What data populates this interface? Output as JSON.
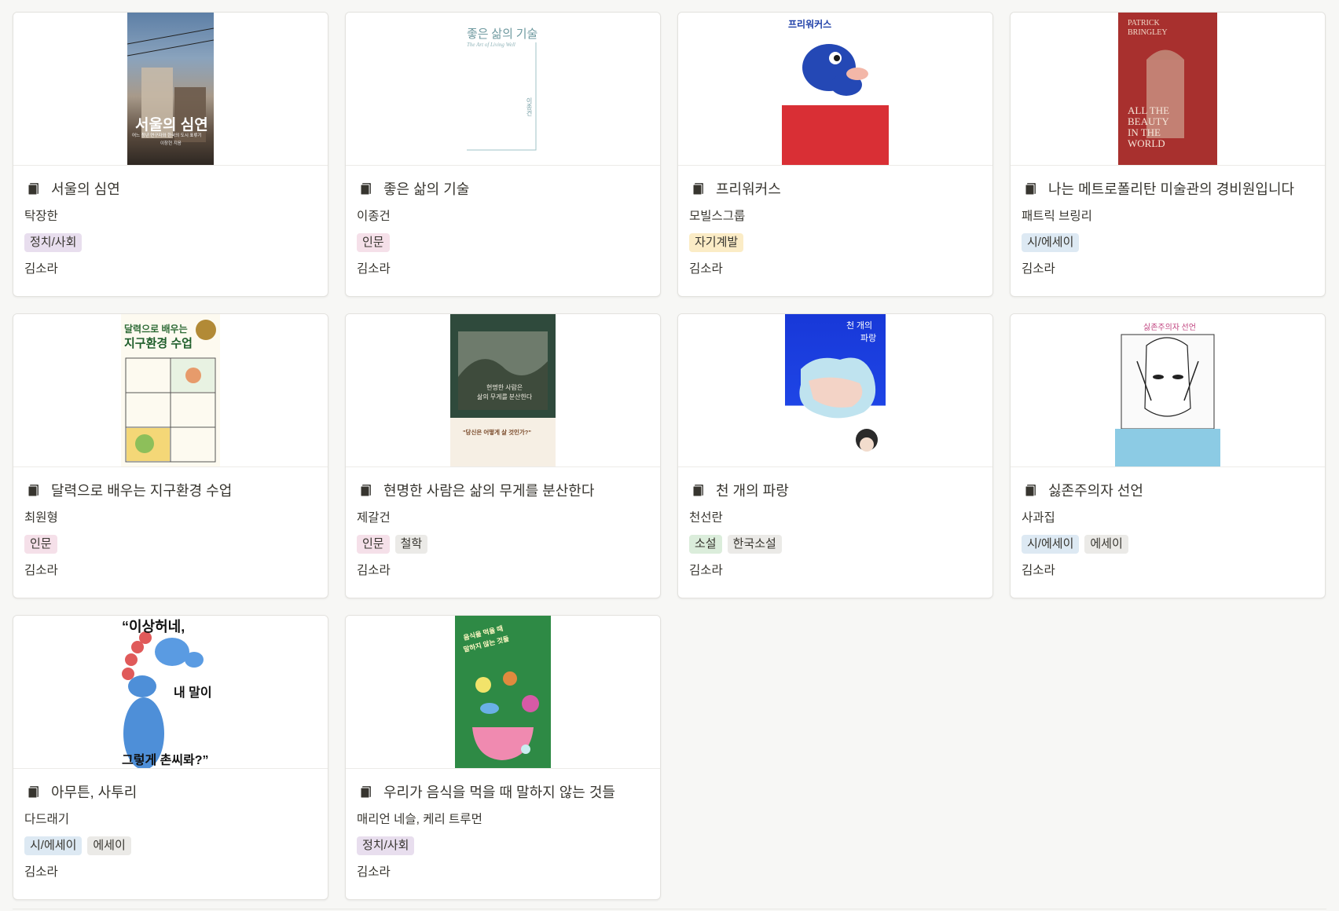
{
  "cards": [
    {
      "title": "서울의 심연",
      "author": "탁장한",
      "tags": [
        {
          "label": "정치/사회",
          "color": "purple"
        }
      ],
      "reader": "김소라",
      "cover": {
        "text": "서울의 심연",
        "sub": "어느 청년 연구자와 한국의 도시 표류기",
        "credit": "이창현 지음"
      }
    },
    {
      "title": "좋은 삶의 기술",
      "author": "이종건",
      "tags": [
        {
          "label": "인문",
          "color": "pink"
        }
      ],
      "reader": "김소라",
      "cover": {
        "text": "좋은 삶의 기술",
        "sub": "The Art of Living Well",
        "credit": "이종건"
      }
    },
    {
      "title": "프리워커스",
      "author": "모빌스그룹",
      "tags": [
        {
          "label": "자기계발",
          "color": "yellow"
        }
      ],
      "reader": "김소라",
      "cover": {
        "text": "프리워커스"
      }
    },
    {
      "title": "나는 메트로폴리탄 미술관의 경비원입니다",
      "author": "패트릭 브링리",
      "tags": [
        {
          "label": "시/에세이",
          "color": "blue"
        }
      ],
      "reader": "김소라",
      "cover": {
        "text": "PATRICK BRINGLEY",
        "sub": "ALL THE BEAUTY IN THE WORLD"
      }
    },
    {
      "title": "달력으로 배우는 지구환경 수업",
      "author": "최원형",
      "tags": [
        {
          "label": "인문",
          "color": "pink"
        }
      ],
      "reader": "김소라",
      "cover": {
        "text": "달력으로 배우는",
        "sub": "지구환경 수업"
      }
    },
    {
      "title": "현명한 사람은 삶의 무게를 분산한다",
      "author": "제갈건",
      "tags": [
        {
          "label": "인문",
          "color": "pink"
        },
        {
          "label": "철학",
          "color": "gray"
        }
      ],
      "reader": "김소라",
      "cover": {
        "text": "현명한 사람은",
        "sub": "삶의 무게를 분산한다",
        "quote": "\"당신은 어떻게 살 것인가?\""
      }
    },
    {
      "title": "천 개의 파랑",
      "author": "천선란",
      "tags": [
        {
          "label": "소설",
          "color": "green"
        },
        {
          "label": "한국소설",
          "color": "gray"
        }
      ],
      "reader": "김소라",
      "cover": {
        "text": "천 개의",
        "sub": "파랑"
      }
    },
    {
      "title": "싫존주의자 선언",
      "author": "사과집",
      "tags": [
        {
          "label": "시/에세이",
          "color": "blue"
        },
        {
          "label": "에세이",
          "color": "gray"
        }
      ],
      "reader": "김소라",
      "cover": {
        "text": "싫존주의자 선언"
      }
    },
    {
      "title": "아무튼, 사투리",
      "author": "다드래기",
      "tags": [
        {
          "label": "시/에세이",
          "color": "blue"
        },
        {
          "label": "에세이",
          "color": "gray"
        }
      ],
      "reader": "김소라",
      "cover": {
        "text": "“이상허네,",
        "sub": "내 말이",
        "quote": "그렇게 촌씨롸?”"
      }
    },
    {
      "title": "우리가 음식을 먹을 때 말하지 않는 것들",
      "author": "매리언 네슬, 케리 트루먼",
      "tags": [
        {
          "label": "정치/사회",
          "color": "purple"
        }
      ],
      "reader": "김소라",
      "cover": {
        "text": "음식을 먹을 때",
        "sub": "말하지 않는 것들"
      }
    }
  ]
}
